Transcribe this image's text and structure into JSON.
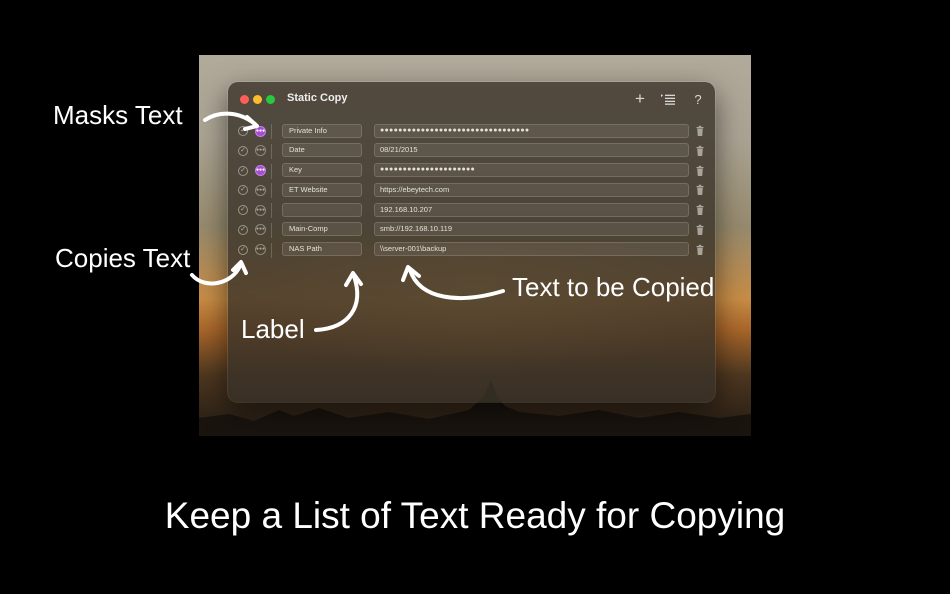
{
  "window": {
    "title": "Static Copy"
  },
  "toolbar": {
    "add_symbol": "+",
    "help_symbol": "?"
  },
  "rows": [
    {
      "label": "Private Info",
      "text": "●●●●●●●●●●●●●●●●●●●●●●●●●●●●●●●●●",
      "masked": true
    },
    {
      "label": "Date",
      "text": "08/21/2015",
      "masked": false
    },
    {
      "label": "Key",
      "text": "●●●●●●●●●●●●●●●●●●●●●",
      "masked": true
    },
    {
      "label": "ET Website",
      "text": "https://ebeytech.com",
      "masked": false
    },
    {
      "label": "",
      "text": "192.168.10.207",
      "masked": false
    },
    {
      "label": "Main-Comp",
      "text": "smb://192.168.10.119",
      "masked": false
    },
    {
      "label": "NAS Path",
      "text": "\\\\server-001\\backup",
      "masked": false
    }
  ],
  "annotations": {
    "masks": "Masks Text",
    "copies": "Copies Text",
    "label": "Label",
    "text": "Text to be Copied"
  },
  "tagline": "Keep a List of Text Ready for Copying",
  "colors": {
    "mask_on": "#a54fd0",
    "close": "#fe5f57",
    "minimize": "#febc2e",
    "zoom": "#28c840"
  }
}
